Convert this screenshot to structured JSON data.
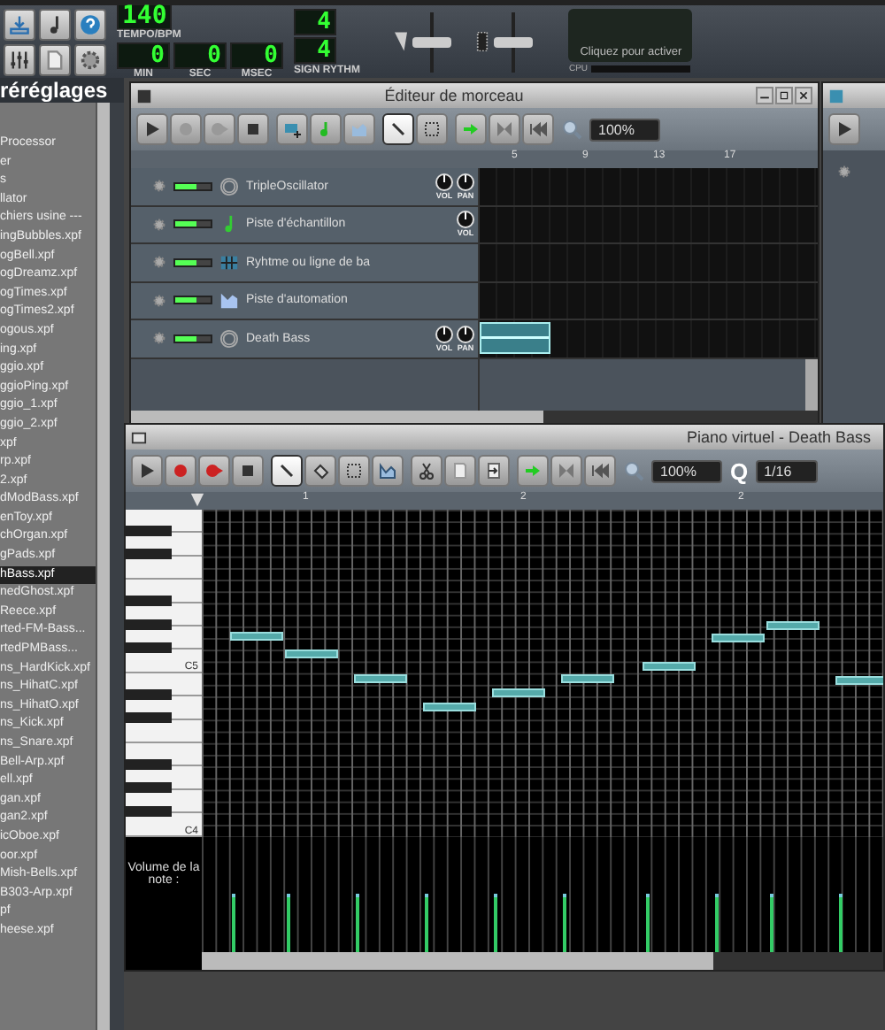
{
  "toolbar": {
    "tempo": {
      "value": "140",
      "label": "TEMPO/BPM"
    },
    "time": [
      {
        "value": "0",
        "label": "MIN"
      },
      {
        "value": "0",
        "label": "SEC"
      },
      {
        "value": "0",
        "label": "MSEC"
      }
    ],
    "signature": {
      "numerator": "4",
      "denominator": "4",
      "label": "SIGN RYTHM"
    },
    "sliders": [
      {
        "kind": "volume",
        "level": 0.5
      },
      {
        "kind": "pitch",
        "level": 0.5
      }
    ],
    "cpu": {
      "message": "Cliquez pour activer",
      "label": "CPU"
    }
  },
  "sidebar": {
    "title": "réréglages",
    "items": [
      {
        "label": "Processor",
        "selected": false
      },
      {
        "label": "er",
        "selected": false
      },
      {
        "label": "s",
        "selected": false
      },
      {
        "label": "llator",
        "selected": false
      },
      {
        "label": "chiers usine ---",
        "selected": false
      },
      {
        "label": "ingBubbles.xpf",
        "selected": false
      },
      {
        "label": "ogBell.xpf",
        "selected": false
      },
      {
        "label": "ogDreamz.xpf",
        "selected": false
      },
      {
        "label": "ogTimes.xpf",
        "selected": false
      },
      {
        "label": "ogTimes2.xpf",
        "selected": false
      },
      {
        "label": "ogous.xpf",
        "selected": false
      },
      {
        "label": "ing.xpf",
        "selected": false
      },
      {
        "label": "ggio.xpf",
        "selected": false
      },
      {
        "label": "ggioPing.xpf",
        "selected": false
      },
      {
        "label": "ggio_1.xpf",
        "selected": false
      },
      {
        "label": "ggio_2.xpf",
        "selected": false
      },
      {
        "label": "xpf",
        "selected": false
      },
      {
        "label": "rp.xpf",
        "selected": false
      },
      {
        "label": "2.xpf",
        "selected": false
      },
      {
        "label": "dModBass.xpf",
        "selected": false
      },
      {
        "label": "enToy.xpf",
        "selected": false
      },
      {
        "label": "chOrgan.xpf",
        "selected": false
      },
      {
        "label": "gPads.xpf",
        "selected": false
      },
      {
        "label": "hBass.xpf",
        "selected": true
      },
      {
        "label": "nedGhost.xpf",
        "selected": false
      },
      {
        "label": "Reece.xpf",
        "selected": false
      },
      {
        "label": "rted-FM-Bass...",
        "selected": false
      },
      {
        "label": "rtedPMBass...",
        "selected": false
      },
      {
        "label": "ns_HardKick.xpf",
        "selected": false
      },
      {
        "label": "ns_HihatC.xpf",
        "selected": false
      },
      {
        "label": "ns_HihatO.xpf",
        "selected": false
      },
      {
        "label": "ns_Kick.xpf",
        "selected": false
      },
      {
        "label": "ns_Snare.xpf",
        "selected": false
      },
      {
        "label": "Bell-Arp.xpf",
        "selected": false
      },
      {
        "label": "ell.xpf",
        "selected": false
      },
      {
        "label": "gan.xpf",
        "selected": false
      },
      {
        "label": "gan2.xpf",
        "selected": false
      },
      {
        "label": "icOboe.xpf",
        "selected": false
      },
      {
        "label": "oor.xpf",
        "selected": false
      },
      {
        "label": "Mish-Bells.xpf",
        "selected": false
      },
      {
        "label": "B303-Arp.xpf",
        "selected": false
      },
      {
        "label": "pf",
        "selected": false
      },
      {
        "label": "heese.xpf",
        "selected": false
      }
    ]
  },
  "song_editor": {
    "title": "Éditeur de morceau",
    "zoom": "100%",
    "tools": [
      {
        "kind": "draw",
        "selected": true
      },
      {
        "kind": "select",
        "selected": false
      }
    ],
    "bars": [
      "5",
      "9",
      "13",
      "17"
    ],
    "tracks": [
      {
        "name": "TripleOscillator",
        "kind": "instrument",
        "active": true,
        "knobs": [
          "VOL",
          "PAN"
        ]
      },
      {
        "name": "Piste d'échantillon",
        "kind": "sample",
        "active": true,
        "knobs": [
          "VOL"
        ]
      },
      {
        "name": "Ryhtme ou ligne de ba",
        "kind": "beat",
        "active": true
      },
      {
        "name": "Piste d'automation",
        "kind": "automation",
        "active": true
      },
      {
        "name": "Death Bass",
        "kind": "instrument",
        "active": true,
        "knobs": [
          "VOL",
          "PAN"
        ],
        "pattern": true
      }
    ]
  },
  "piano_roll": {
    "title": "Piano virtuel - Death Bass",
    "zoom": "100%",
    "quantize_label": "Q",
    "quantize": "1/16",
    "tools": [
      {
        "kind": "draw",
        "selected": true
      },
      {
        "kind": "erase",
        "selected": false
      },
      {
        "kind": "select",
        "selected": false
      },
      {
        "kind": "detune",
        "selected": false
      }
    ],
    "bars": [
      "1",
      "2",
      "2"
    ],
    "key_labels": [
      "C5",
      "C4"
    ],
    "volume_label": "Volume de la note :"
  }
}
